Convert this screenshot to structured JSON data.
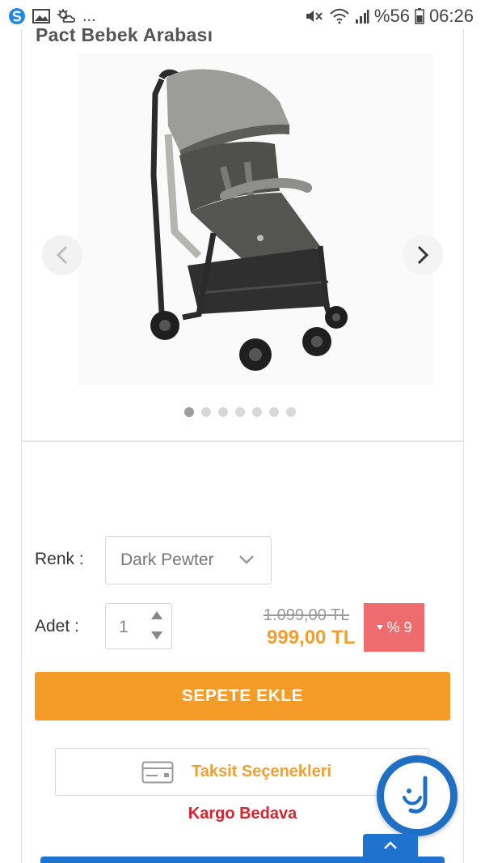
{
  "status_bar": {
    "dots": "...",
    "battery_percent": "%56",
    "time": "06:26",
    "icons": [
      "s-app-icon",
      "image-icon",
      "weather-icon",
      "mute-icon",
      "wifi-icon",
      "signal-icon",
      "battery-icon"
    ]
  },
  "product": {
    "title": "Pact Bebek Arabası",
    "image_icon": "stroller-image",
    "gallery_slide_count": 7,
    "gallery_active_index": 0
  },
  "options": {
    "color_label": "Renk :",
    "color_value": "Dark Pewter",
    "quantity_label": "Adet :",
    "quantity_value": "1"
  },
  "pricing": {
    "old_price": "1.099,00 TL",
    "new_price": "999,00 TL",
    "discount": "% 9"
  },
  "actions": {
    "add_to_cart": "SEPETE EKLE",
    "installments": "Taksit Seçenekleri",
    "shipping": "Kargo Bedava"
  },
  "colors": {
    "accent_orange": "#f59c28",
    "discount_red": "#ef6c6e",
    "shipping_red": "#d9232e",
    "brand_blue": "#1e73cf"
  }
}
